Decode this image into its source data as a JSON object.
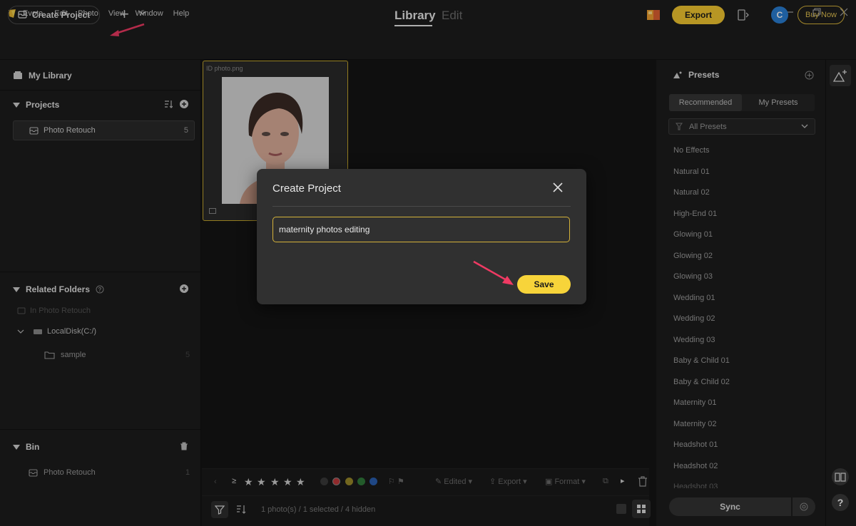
{
  "app": {
    "name": "Evoto",
    "menu": [
      "Evoto",
      "Edit",
      "Photo",
      "View",
      "Window",
      "Help"
    ]
  },
  "toolbar": {
    "create_project_label": "Create Project",
    "tabs": {
      "library": "Library",
      "edit": "Edit"
    },
    "export_label": "Export",
    "avatar_initial": "C",
    "buy_now_label": "Buy Now"
  },
  "sidebar": {
    "my_library": "My Library",
    "projects_header": "Projects",
    "projects": [
      {
        "name": "Photo Retouch",
        "count": "5"
      }
    ],
    "related_folders_header": "Related Folders",
    "in_project": "In Photo Retouch",
    "disk": "LocalDisk(C:/)",
    "folder": {
      "name": "sample",
      "count": "5"
    },
    "bin_header": "Bin",
    "bin_items": [
      {
        "name": "Photo Retouch",
        "count": "1"
      }
    ]
  },
  "grid": {
    "thumb_name": "ID photo.png"
  },
  "bottom_bar": {
    "rating_prefix": "≥",
    "edited_label": "Edited",
    "export_label": "Export",
    "format_label": "Format",
    "status_text": "1 photo(s) / 1 selected / 4 hidden",
    "color_labels": [
      "#3a3a3a",
      "#c0393b",
      "#9a8a2a",
      "#2f7a3a",
      "#2a5fb0"
    ]
  },
  "presets": {
    "title": "Presets",
    "tabs": [
      "Recommended",
      "My Presets"
    ],
    "filter": "All Presets",
    "items": [
      "No Effects",
      "Natural 01",
      "Natural 02",
      "High-End 01",
      "Glowing 01",
      "Glowing 02",
      "Glowing 03",
      "Wedding 01",
      "Wedding 02",
      "Wedding 03",
      "Baby & Child 01",
      "Baby & Child 02",
      "Maternity 01",
      "Maternity 02",
      "Headshot 01",
      "Headshot 02",
      "Headshot 03"
    ],
    "sync_label": "Sync"
  },
  "dialog": {
    "title": "Create Project",
    "input_value": "maternity photos editing",
    "save_label": "Save"
  },
  "colors": {
    "accent": "#f4c930",
    "annotation_arrow": "#ef3a63"
  }
}
